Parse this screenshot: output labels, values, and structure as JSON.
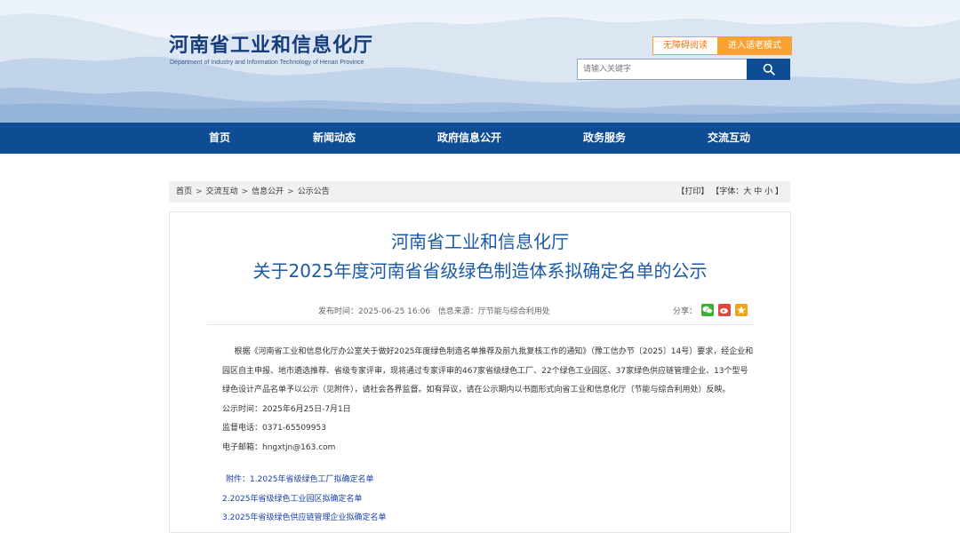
{
  "header": {
    "title": "河南省工业和信息化厅",
    "subtitle": "Department of Industry and Information Technology of Henan Province",
    "btn_accessible": "无障碍阅读",
    "btn_elderly": "进入适老模式",
    "search_placeholder": "请输入关键字"
  },
  "nav": {
    "items": [
      "首页",
      "新闻动态",
      "政府信息公开",
      "政务服务",
      "交流互动"
    ]
  },
  "breadcrumb": {
    "items": [
      "首页",
      "交流互动",
      "信息公开",
      "公示公告"
    ],
    "sep": ">",
    "print": "【打印】",
    "font_label": "【字体：",
    "font_large": "大",
    "font_medium": "中",
    "font_small": "小",
    "font_close": "】"
  },
  "article": {
    "title_line1": "河南省工业和信息化厅",
    "title_line2": "关于2025年度河南省省级绿色制造体系拟确定名单的公示",
    "publish_time": "发布时间：2025-06-25 16:06",
    "source": "信息来源：厅节能与综合利用处",
    "share_label": "分享：",
    "paragraph": "根据《河南省工业和信息化厅办公室关于做好2025年度绿色制造名单推荐及前九批复核工作的通知》（豫工信办节〔2025〕14号）要求，经企业和园区自主申报、地市遴选推荐、省级专家评审，现将通过专家评审的467家省级绿色工厂、22个绿色工业园区、37家绿色供应链管理企业、13个型号绿色设计产品名单予以公示（见附件），请社会各界监督。如有异议，请在公示期内以书面形式向省工业和信息化厅（节能与综合利用处）反映。",
    "period": "公示时间：2025年6月25日-7月1日",
    "phone": "监督电话：0371-65509953",
    "email": "电子邮箱：hngxtjn@163.com",
    "attachments": [
      "附件：1.2025年省级绿色工厂拟确定名单",
      "2.2025年省级绿色工业园区拟确定名单",
      "3.2025年省级绿色供应链管理企业拟确定名单"
    ]
  },
  "colors": {
    "nav": "#0e4d93",
    "title": "#1a5aa6",
    "link": "#1a3fa8",
    "accent": "#f7a233"
  }
}
